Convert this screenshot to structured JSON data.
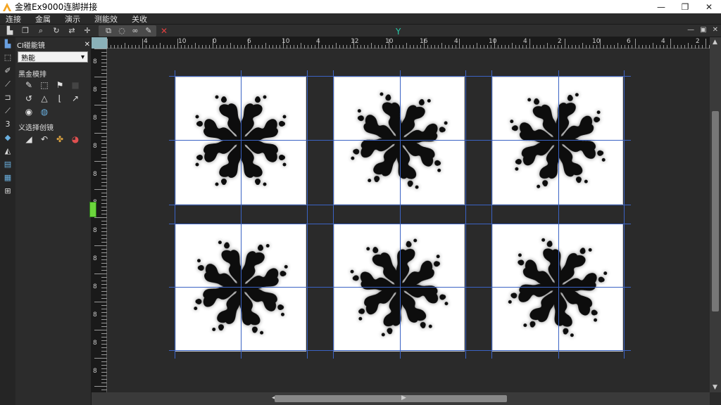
{
  "window": {
    "title": "金雅Ex9000连脚拼接",
    "min_label": "—",
    "max_label": "❐",
    "close_label": "✕"
  },
  "menu": [
    "连接",
    "金属",
    "演示",
    "测能效",
    "关收"
  ],
  "toolbar": {
    "close_label": "✕"
  },
  "left_panel": {
    "header": "CI碰能镜",
    "close_label": "✕",
    "dropdown_value": "熟能",
    "section1": "黑金模排",
    "section2": "义选择创镜"
  },
  "ruler": {
    "top_labels": [
      "4",
      "10",
      "0",
      "6",
      "10",
      "4",
      "12",
      "10",
      "16",
      "4",
      "10",
      "4",
      "2",
      "10",
      "6",
      "4",
      "2"
    ],
    "left_labels": [
      "8",
      "8",
      "8",
      "8",
      "8",
      "8",
      "8",
      "8",
      "8",
      "8",
      "8",
      "8"
    ]
  },
  "canvas": {
    "tiles": [
      "tile-1",
      "tile-2",
      "tile-3",
      "tile-4",
      "tile-5",
      "tile-6"
    ]
  },
  "colors": {
    "guide": "#3b63c4",
    "accent_green": "#6cd63c",
    "background": "#2a2a2a"
  }
}
